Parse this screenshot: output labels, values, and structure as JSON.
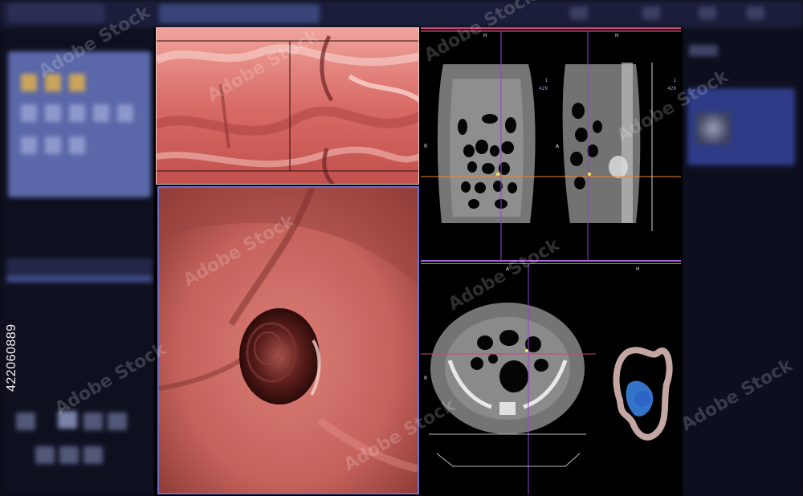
{
  "viewports": {
    "coronal": {
      "orient_top": "H",
      "orient_left": "R",
      "index_top": "1",
      "index_bottom": "429"
    },
    "sagittal": {
      "orient_top": "H",
      "orient_left": "A",
      "index_top": "1",
      "index_bottom": "429"
    },
    "axial": {
      "orient_top": "A",
      "orient_left": "R"
    },
    "model_3d": {
      "orient_top": "H"
    }
  },
  "watermark": {
    "brand": "Adobe Stock",
    "stock_id": "422060889"
  },
  "colors": {
    "mucosa": "#d86f6a",
    "active_frame": "#6f6cc8",
    "crosshair_orange": "#e8892a",
    "crosshair_purple": "#9a3fd8",
    "crosshair_pink": "#d0417a",
    "colon_blue": "#3a7fe0"
  }
}
